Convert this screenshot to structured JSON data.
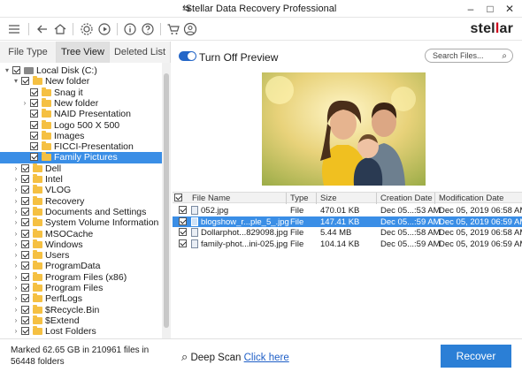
{
  "window": {
    "title": "Stellar Data Recovery Professional",
    "controls": [
      "–",
      "□",
      "✕"
    ]
  },
  "toolbar": {
    "brand_prefix": "stel",
    "brand_accent": "l",
    "brand_suffix": "ar",
    "accent_color": "#d0021b",
    "icons": [
      "menu-icon",
      "back-icon",
      "home-icon",
      "settings-icon",
      "video-icon",
      "info-icon",
      "help-icon",
      "cart-icon",
      "account-icon"
    ]
  },
  "tabs": [
    "File Type",
    "Tree View",
    "Deleted List"
  ],
  "active_tab": "Tree View",
  "tree": [
    {
      "label": "Local Disk (C:)",
      "level": 0,
      "expanded": true,
      "drive": true
    },
    {
      "label": "New folder",
      "level": 1,
      "expanded": true
    },
    {
      "label": "Snag it",
      "level": 2
    },
    {
      "label": "New folder",
      "level": 2,
      "collapsed": true
    },
    {
      "label": "NAID Presentation",
      "level": 2
    },
    {
      "label": "Logo 500 X 500",
      "level": 2
    },
    {
      "label": "Images",
      "level": 2
    },
    {
      "label": "FICCI-Presentation",
      "level": 2
    },
    {
      "label": "Family Pictures",
      "level": 2,
      "selected": true
    },
    {
      "label": "Dell",
      "level": 1,
      "collapsed": true
    },
    {
      "label": "Intel",
      "level": 1,
      "collapsed": true
    },
    {
      "label": "VLOG",
      "level": 1,
      "collapsed": true
    },
    {
      "label": "Recovery",
      "level": 1,
      "collapsed": true
    },
    {
      "label": "Documents and Settings",
      "level": 1,
      "collapsed": true
    },
    {
      "label": "System Volume Information",
      "level": 1,
      "collapsed": true
    },
    {
      "label": "MSOCache",
      "level": 1,
      "collapsed": true
    },
    {
      "label": "Windows",
      "level": 1,
      "collapsed": true
    },
    {
      "label": "Users",
      "level": 1,
      "collapsed": true
    },
    {
      "label": "ProgramData",
      "level": 1,
      "collapsed": true
    },
    {
      "label": "Program Files (x86)",
      "level": 1,
      "collapsed": true
    },
    {
      "label": "Program Files",
      "level": 1,
      "collapsed": true
    },
    {
      "label": "PerfLogs",
      "level": 1,
      "collapsed": true
    },
    {
      "label": "$Recycle.Bin",
      "level": 1,
      "collapsed": true
    },
    {
      "label": "$Extend",
      "level": 1,
      "collapsed": true
    },
    {
      "label": "Lost Folders",
      "level": 1,
      "collapsed": true
    }
  ],
  "preview": {
    "toggle_label": "Turn Off Preview",
    "search_placeholder": "Search Files..."
  },
  "file_table": {
    "headers": [
      "File Name",
      "Type",
      "Size",
      "Creation Date",
      "Modification Date"
    ],
    "rows": [
      {
        "name": "052.jpg",
        "type": "File",
        "size": "470.01 KB",
        "created": "Dec 05...:53 AM",
        "modified": "Dec 05, 2019 06:58 AM"
      },
      {
        "name": "blogshow_r...ple_5_.jpg",
        "type": "File",
        "size": "147.41 KB",
        "created": "Dec 05...:59 AM",
        "modified": "Dec 05, 2019 06:59 AM",
        "selected": true
      },
      {
        "name": "Dollarphot...829098.jpg",
        "type": "File",
        "size": "5.44 MB",
        "created": "Dec 05...:58 AM",
        "modified": "Dec 05, 2019 06:58 AM"
      },
      {
        "name": "family-phot...ini-025.jpg",
        "type": "File",
        "size": "104.14 KB",
        "created": "Dec 05...:59 AM",
        "modified": "Dec 05, 2019 06:59 AM"
      }
    ]
  },
  "status": {
    "text": "Marked 62.65 GB in 210961 files in 56448 folders"
  },
  "deep_scan": {
    "label": "Deep Scan",
    "link": "Click here"
  },
  "recover_button": "Recover"
}
